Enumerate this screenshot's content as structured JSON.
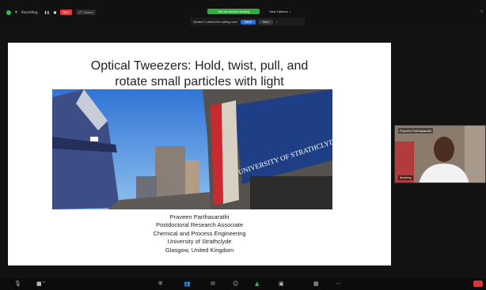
{
  "topbar": {
    "meeting_label": "Recording...",
    "rec_label": "REC",
    "ct_label": "CT Closed",
    "share_pill": "You are screen sharing",
    "view_options": "View Options ⌄",
    "right_icon": "⠿"
  },
  "notice": {
    "text": "Speaker 2 started the waiting room",
    "allow": "Admit",
    "deny": "View",
    "close": "×"
  },
  "slide": {
    "title_line1": "Optical Tweezers: Hold, twist, pull, and",
    "title_line2": "rotate small particles with light",
    "building_sign": "UNIVERSITY OF STRATHCLYDE",
    "credits": [
      "Praveen Parthasarathi",
      "Postdoctoral Research Associate",
      "Chemical and Process Engineering",
      "University of Strathclyde",
      "Glasgow, United Kingdom"
    ]
  },
  "camera": {
    "name": "Praveen Parthasarathi",
    "tag": "Speaking"
  },
  "bottombar": {
    "icons": [
      "mic-icon",
      "video-icon",
      "security-icon",
      "participants-icon",
      "chat-icon",
      "share-screen-icon",
      "record-icon",
      "reactions-icon",
      "apps-icon",
      "more-icon"
    ]
  },
  "colors": {
    "share_green": "#2fae3d",
    "rec_red": "#e23535",
    "end_red": "#d83434",
    "sign_blue": "#1e4fa0"
  }
}
